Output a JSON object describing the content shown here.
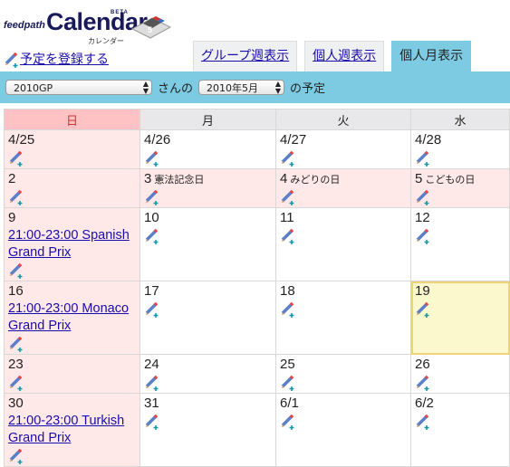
{
  "logo": {
    "prefix": "feedpath",
    "name": "Calendar",
    "beta": "BETA",
    "kana": "カレンダー"
  },
  "add_event_label": "予定を登録する",
  "tabs": [
    {
      "label": "グループ週表示",
      "active": false
    },
    {
      "label": "個人週表示",
      "active": false
    },
    {
      "label": "個人月表示",
      "active": true
    }
  ],
  "filter": {
    "user": "2010GP",
    "suffix_user": "さんの",
    "month": "2010年5月",
    "suffix_month": "の予定"
  },
  "colors": {
    "accent": "#7ccbe3",
    "sunday_header": "#ffc2c4",
    "holiday_bg": "#ffe8e8",
    "today_bg": "#fbf8cd",
    "link": "#1a0dab"
  },
  "weekdays": [
    "日",
    "月",
    "火",
    "水"
  ],
  "weeks": [
    [
      {
        "date": "4/25",
        "sun": true
      },
      {
        "date": "4/26"
      },
      {
        "date": "4/27"
      },
      {
        "date": "4/28"
      }
    ],
    [
      {
        "date": "2",
        "sun": true
      },
      {
        "date": "3",
        "holiday": "憲法記念日"
      },
      {
        "date": "4",
        "holiday": "みどりの日"
      },
      {
        "date": "5",
        "holiday": "こどもの日"
      }
    ],
    [
      {
        "date": "9",
        "sun": true,
        "events": [
          "21:00-23:00 Spanish Grand Prix"
        ]
      },
      {
        "date": "10"
      },
      {
        "date": "11"
      },
      {
        "date": "12"
      }
    ],
    [
      {
        "date": "16",
        "sun": true,
        "events": [
          "21:00-23:00 Monaco Grand Prix"
        ]
      },
      {
        "date": "17"
      },
      {
        "date": "18"
      },
      {
        "date": "19",
        "today": true
      }
    ],
    [
      {
        "date": "23",
        "sun": true
      },
      {
        "date": "24"
      },
      {
        "date": "25"
      },
      {
        "date": "26"
      }
    ],
    [
      {
        "date": "30",
        "sun": true,
        "events": [
          "21:00-23:00 Turkish Grand Prix"
        ]
      },
      {
        "date": "31"
      },
      {
        "date": "6/1"
      },
      {
        "date": "6/2"
      }
    ]
  ],
  "icons": {
    "add": "pencil-add-icon",
    "logo_badge": "calendar-badge-icon"
  }
}
